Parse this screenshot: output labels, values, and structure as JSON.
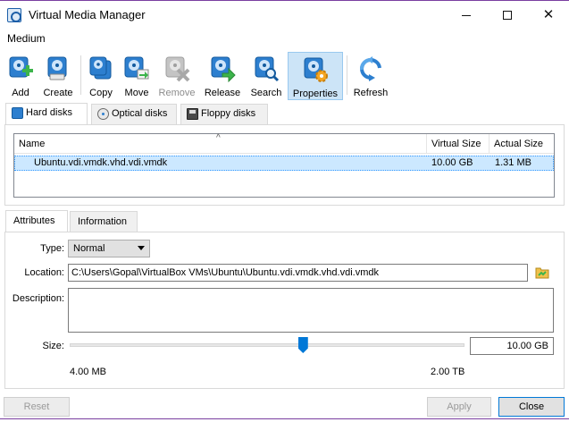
{
  "window": {
    "title": "Virtual Media Manager"
  },
  "menubar": {
    "items": [
      {
        "label": "Medium"
      }
    ]
  },
  "toolbar": {
    "buttons": [
      {
        "label": "Add",
        "icon": "add-disk-icon",
        "enabled": true
      },
      {
        "label": "Create",
        "icon": "create-disk-icon",
        "enabled": true
      },
      {
        "label": "Copy",
        "icon": "copy-disk-icon",
        "enabled": true
      },
      {
        "label": "Move",
        "icon": "move-disk-icon",
        "enabled": true
      },
      {
        "label": "Remove",
        "icon": "remove-disk-icon",
        "enabled": false
      },
      {
        "label": "Release",
        "icon": "release-disk-icon",
        "enabled": true
      },
      {
        "label": "Search",
        "icon": "search-disk-icon",
        "enabled": true
      },
      {
        "label": "Properties",
        "icon": "properties-disk-icon",
        "enabled": true,
        "active": true
      },
      {
        "label": "Refresh",
        "icon": "refresh-icon",
        "enabled": true
      }
    ]
  },
  "media_tabs": [
    {
      "label": "Hard disks",
      "icon": "hard-disk-icon",
      "selected": true
    },
    {
      "label": "Optical disks",
      "icon": "optical-disk-icon",
      "selected": false
    },
    {
      "label": "Floppy disks",
      "icon": "floppy-disk-icon",
      "selected": false
    }
  ],
  "table": {
    "columns": [
      "Name",
      "Virtual Size",
      "Actual Size"
    ],
    "rows": [
      {
        "name": "Ubuntu.vdi.vmdk.vhd.vdi.vmdk",
        "virtual_size": "10.00 GB",
        "actual_size": "1.31 MB",
        "selected": true
      }
    ]
  },
  "detail_tabs": [
    {
      "label": "Attributes",
      "selected": true
    },
    {
      "label": "Information",
      "selected": false
    }
  ],
  "attributes": {
    "type_label": "Type:",
    "type_value": "Normal",
    "location_label": "Location:",
    "location_value": "C:\\Users\\Gopal\\VirtualBox VMs\\Ubuntu\\Ubuntu.vdi.vmdk.vhd.vdi.vmdk",
    "description_label": "Description:",
    "description_value": "",
    "size_label": "Size:",
    "size_value": "10.00 GB",
    "size_min_label": "4.00 MB",
    "size_max_label": "2.00 TB",
    "slider_fraction": 0.59
  },
  "buttons": {
    "reset": "Reset",
    "apply": "Apply",
    "close": "Close"
  },
  "colors": {
    "accent": "#0078d7",
    "selection": "#cce8ff",
    "window_border": "#7a3fa0"
  }
}
